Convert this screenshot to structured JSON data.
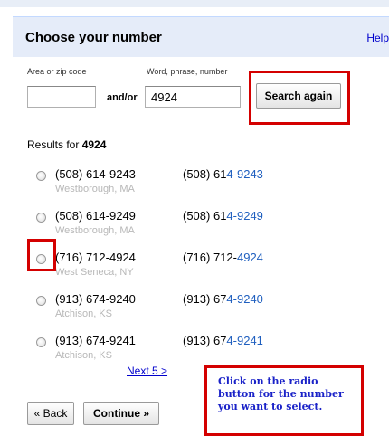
{
  "header": {
    "title": "Choose your number",
    "help": "Help"
  },
  "form": {
    "area_label": "Area or zip code",
    "area_value": "",
    "andor_label": "and/or",
    "word_label": "Word, phrase, number",
    "word_value": "4924",
    "search_button": "Search again"
  },
  "results": {
    "prefix": "Results for",
    "query": "4924",
    "items": [
      {
        "number": "(508) 614-9243",
        "location": "Westborough, MA",
        "right_plain": "(508) 61",
        "right_highlight": "4-9243"
      },
      {
        "number": "(508) 614-9249",
        "location": "Westborough, MA",
        "right_plain": "(508) 61",
        "right_highlight": "4-9249"
      },
      {
        "number": "(716) 712-4924",
        "location": "West Seneca, NY",
        "right_plain": "(716) 712-",
        "right_highlight": "4924"
      },
      {
        "number": "(913) 674-9240",
        "location": "Atchison, KS",
        "right_plain": "(913) 67",
        "right_highlight": "4-9240"
      },
      {
        "number": "(913) 674-9241",
        "location": "Atchison, KS",
        "right_plain": "(913) 67",
        "right_highlight": "4-9241"
      }
    ],
    "next_link": "Next 5 >"
  },
  "footer": {
    "back_button": "« Back",
    "continue_button": "Continue »"
  },
  "annotation": {
    "text": "Click on the radio button for the number you want to select."
  },
  "colors": {
    "highlight_red": "#d40000",
    "header_bg": "#e5ecf9",
    "match_blue": "#1f5fbf",
    "callout_text": "#1a22c8"
  }
}
